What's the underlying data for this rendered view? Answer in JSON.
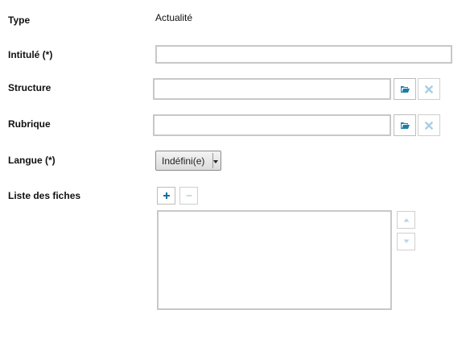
{
  "form": {
    "type": {
      "label": "Type",
      "value": "Actualité"
    },
    "intitule": {
      "label": "Intitulé (*)",
      "value": ""
    },
    "structure": {
      "label": "Structure",
      "value": ""
    },
    "rubrique": {
      "label": "Rubrique",
      "value": ""
    },
    "langue": {
      "label": "Langue (*)",
      "selected": "Indéfini(e)"
    },
    "liste_fiches": {
      "label": "Liste des fiches",
      "items": []
    }
  },
  "colors": {
    "browse_icon": "#1a7fa6",
    "clear_icon_disabled": "#a9cfe0",
    "add_icon": "#1a6f98",
    "disabled_icon": "#b8d6e3"
  },
  "icons": {
    "browse": "folder-open-icon",
    "clear": "clear-x-icon",
    "add": "plus-icon",
    "remove": "minus-icon",
    "up": "arrow-up-icon",
    "down": "arrow-down-icon"
  }
}
